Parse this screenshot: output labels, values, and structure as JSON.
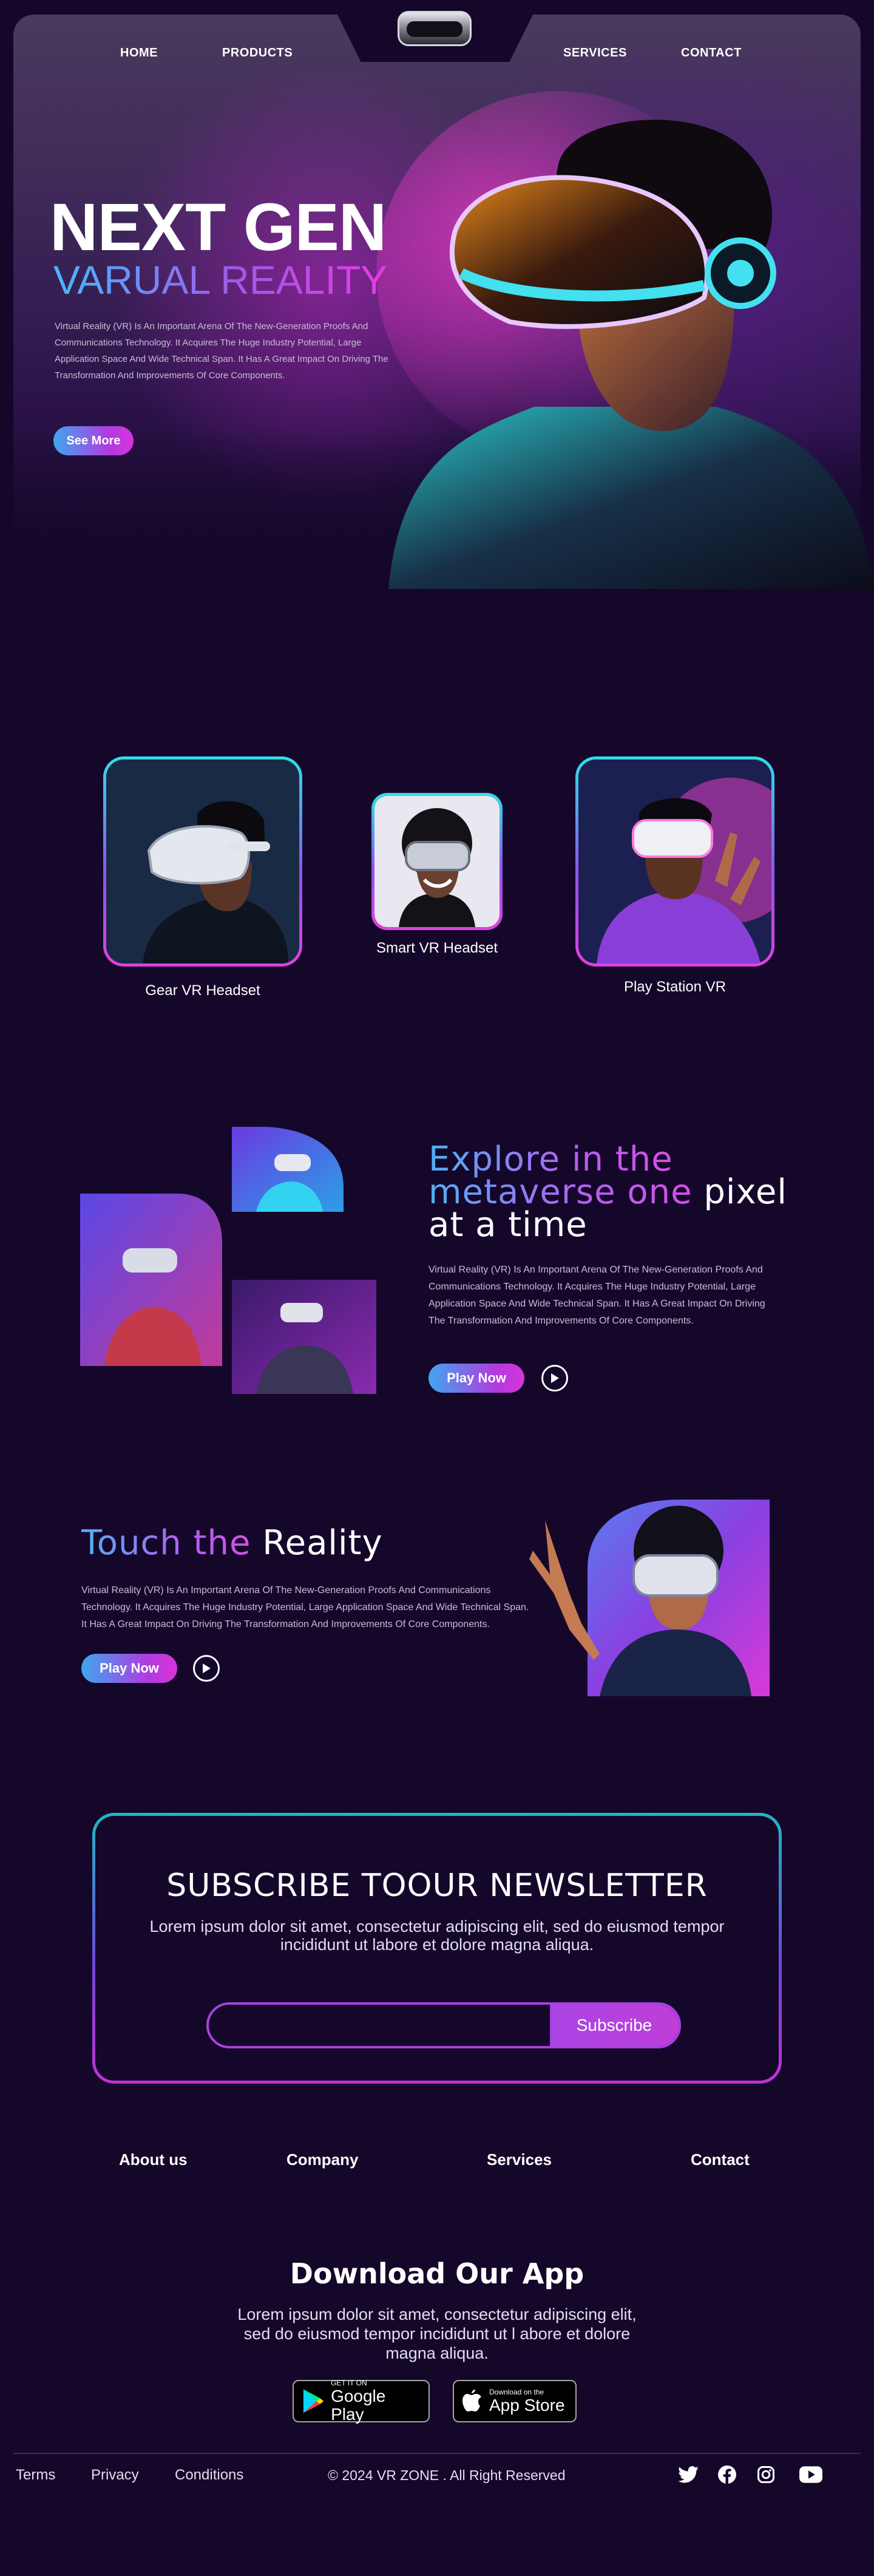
{
  "nav": {
    "home": "HOME",
    "products": "PRODUCTS",
    "services": "SERVICES",
    "contact": "CONTACT"
  },
  "hero": {
    "title": "NEXT GEN",
    "subtitle": "VARUAL REALITY",
    "description": "Virtual Reality (VR) Is An Important Arena Of The New-Generation Proofs And Communications Technology. It Acquires The Huge Industry Potential, Large Application Space And Wide Technical Span. It Has A Great Impact On Driving The Transformation And Improvements Of Core Components.",
    "button": "See More"
  },
  "products": [
    {
      "label": "Gear VR Headset"
    },
    {
      "label": "Smart VR Headset"
    },
    {
      "label": "Play Station VR"
    }
  ],
  "explore": {
    "title_part1": "Explore in the",
    "title_part2": "metaverse one",
    "title_part3": "pixel",
    "title_part4": "at a time",
    "description": "Virtual Reality (VR) Is An Important Arena Of The New-Generation Proofs And Communications Technology. It Acquires The Huge Industry Potential, Large Application Space And Wide Technical Span. It Has A Great Impact On Driving The Transformation And Improvements Of Core Components.",
    "button": "Play Now"
  },
  "touch": {
    "title_part1": "Touch the",
    "title_part2": "Reality",
    "description": "Virtual Reality (VR) Is An Important Arena Of The New-Generation Proofs And Communications Technology. It Acquires The Huge Industry Potential, Large Application Space And Wide Technical Span. It Has A Great Impact On Driving The Transformation And Improvements Of Core Components.",
    "button": "Play Now"
  },
  "newsletter": {
    "title": "SUBSCRIBE TOOUR NEWSLETTER",
    "description": "Lorem ipsum dolor sit amet, consectetur adipiscing elit, sed do eiusmod tempor incididunt ut labore et dolore magna aliqua.",
    "input_placeholder": "",
    "button": "Subscribe"
  },
  "footer_links": {
    "about": "About us",
    "company": "Company",
    "services": "Services",
    "contact": "Contact"
  },
  "app": {
    "title": "Download Our App",
    "description": "Lorem ipsum dolor sit amet, consectetur adipiscing elit, sed do eiusmod tempor incididunt ut l abore et dolore magna aliqua.",
    "google_small": "GET IT ON",
    "google_big": "Google Play",
    "apple_small": "Download on the",
    "apple_big": "App Store"
  },
  "bottom": {
    "terms": "Terms",
    "privacy": "Privacy",
    "conditions": "Conditions",
    "copyright": "© 2024 VR ZONE .  All Right Reserved"
  },
  "social_icons": [
    "twitter-icon",
    "facebook-icon",
    "instagram-icon",
    "youtube-icon"
  ],
  "colors": {
    "background": "#14072a",
    "accent_blue": "#4fb0f2",
    "accent_pink": "#d64fe8",
    "accent_cyan": "#2fe0e8"
  }
}
